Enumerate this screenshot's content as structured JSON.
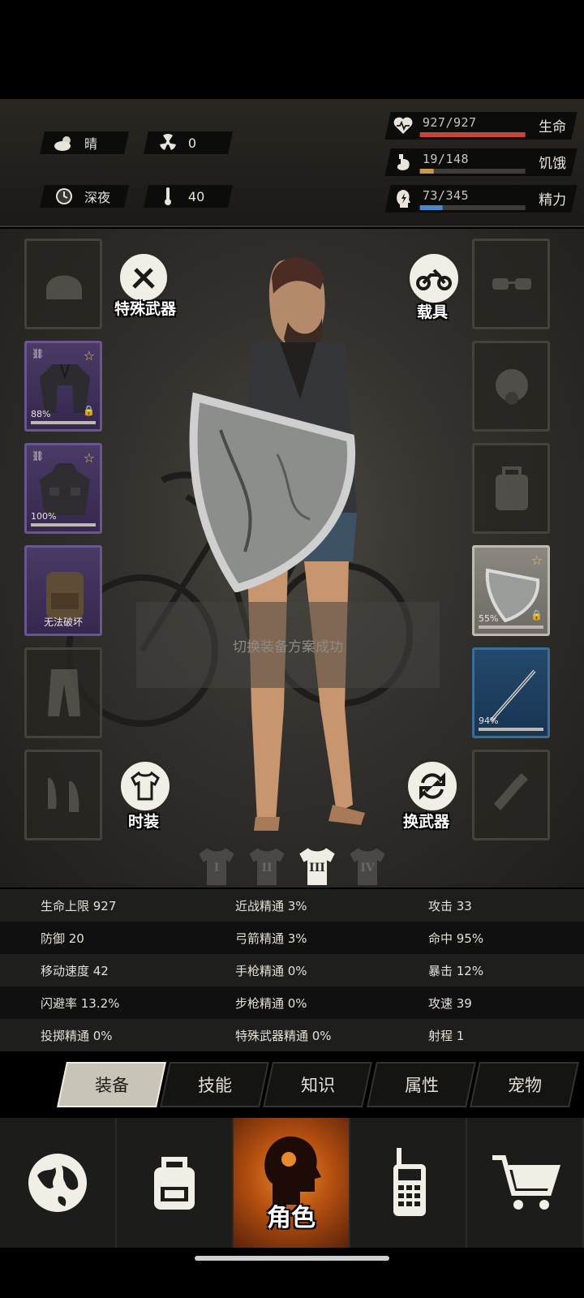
{
  "status": {
    "weather": "晴",
    "radiation": "0",
    "time_of_day": "深夜",
    "temperature": "40"
  },
  "vitals": [
    {
      "label": "生命",
      "value": "927/927",
      "fill": 1.0,
      "color": "#c8453a",
      "icon": "heart-pulse-icon"
    },
    {
      "label": "饥饿",
      "value": "19/148",
      "fill": 0.128,
      "color": "#c89a4a",
      "icon": "stomach-icon"
    },
    {
      "label": "精力",
      "value": "73/345",
      "fill": 0.212,
      "color": "#4a86c8",
      "icon": "head-energy-icon"
    }
  ],
  "buttons": {
    "special_weapon": "特殊武器",
    "vehicle": "载具",
    "fashion": "时装",
    "switch_weapon": "换武器"
  },
  "left_slots": [
    {
      "type": "empty",
      "icon": "helmet-icon"
    },
    {
      "type": "purple",
      "icon": "jacket-icon",
      "percent": "88%",
      "starred": true,
      "locked": true,
      "linked": true
    },
    {
      "type": "purple",
      "icon": "hooded-jacket-icon",
      "percent": "100%",
      "starred": true,
      "locked": false,
      "linked": true
    },
    {
      "type": "purple",
      "icon": "backpack-icon",
      "note": "无法破坏"
    },
    {
      "type": "empty",
      "icon": "pants-icon"
    },
    {
      "type": "empty",
      "icon": "shoes-icon"
    }
  ],
  "right_slots": [
    {
      "type": "empty",
      "icon": "glasses-icon"
    },
    {
      "type": "empty",
      "icon": "gas-mask-icon"
    },
    {
      "type": "empty",
      "icon": "bag-icon"
    },
    {
      "type": "gray",
      "icon": "shield-icon",
      "percent": "55%",
      "starred": true,
      "locked": true
    },
    {
      "type": "blue",
      "icon": "metal-rod-icon",
      "percent": "94%"
    },
    {
      "type": "empty",
      "icon": "bottle-icon"
    }
  ],
  "toast": "切换装备方案成功",
  "loadouts": [
    {
      "label": "I",
      "active": false
    },
    {
      "label": "II",
      "active": false
    },
    {
      "label": "III",
      "active": true
    },
    {
      "label": "IV",
      "active": false
    }
  ],
  "stats": [
    [
      "生命上限 927",
      "近战精通 3%",
      "攻击 33"
    ],
    [
      "防御 20",
      "弓箭精通 3%",
      "命中 95%"
    ],
    [
      "移动速度 42",
      "手枪精通 0%",
      "暴击 12%"
    ],
    [
      "闪避率 13.2%",
      "步枪精通 0%",
      "攻速 39"
    ],
    [
      "投掷精通 0%",
      "特殊武器精通 0%",
      "射程 1"
    ]
  ],
  "tabs": [
    {
      "label": "装备",
      "active": true
    },
    {
      "label": "技能",
      "active": false
    },
    {
      "label": "知识",
      "active": false
    },
    {
      "label": "属性",
      "active": false
    },
    {
      "label": "宠物",
      "active": false
    }
  ],
  "bottom_nav": [
    {
      "icon": "globe-icon"
    },
    {
      "icon": "backpack-icon"
    },
    {
      "icon": "character-head-icon",
      "label": "角色",
      "active": true
    },
    {
      "icon": "walkie-talkie-icon"
    },
    {
      "icon": "shopping-cart-icon"
    }
  ]
}
